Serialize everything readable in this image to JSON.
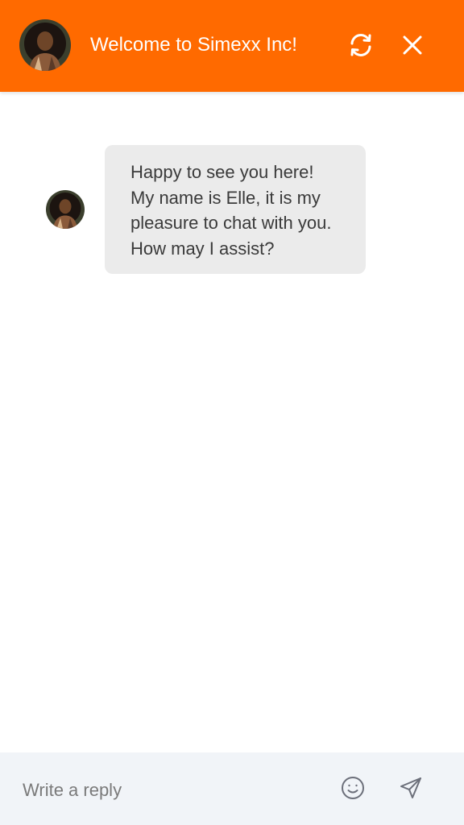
{
  "header": {
    "title": "Welcome to Simexx Inc!",
    "agent_name": "Elle",
    "refresh_icon": "refresh-icon",
    "close_icon": "close-icon"
  },
  "messages": [
    {
      "from": "agent",
      "text": "Happy to see you here! My name is Elle, it is my pleasure to chat with you. How may I assist?"
    }
  ],
  "composer": {
    "placeholder": "Write a reply",
    "emoji_icon": "emoji-icon",
    "send_icon": "send-icon"
  },
  "colors": {
    "header_bg": "#ff6a00",
    "bubble_bg": "#ebebeb",
    "composer_bg": "#f1f4f8",
    "icon_gray": "#6c6f7a"
  }
}
